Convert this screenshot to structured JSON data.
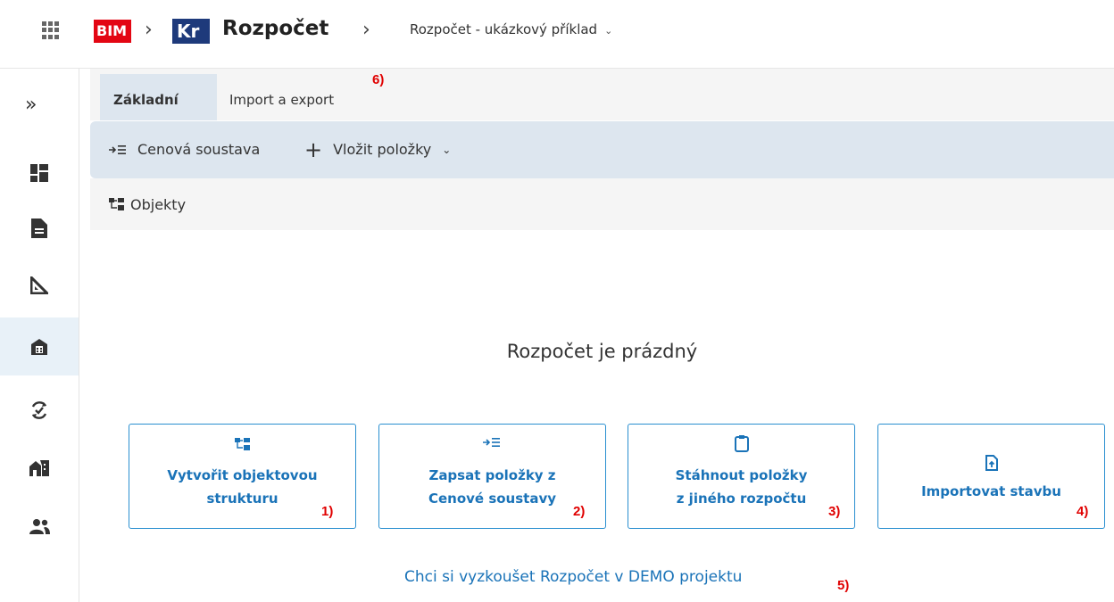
{
  "header": {
    "bim_logo": "BIM",
    "kr_logo": "Kr",
    "app_title": "Rozpočet",
    "project_name": "Rozpočet - ukázkový příklad"
  },
  "tabs": [
    {
      "label": "Základní"
    },
    {
      "label": "Import a export"
    }
  ],
  "toolbar": {
    "price_system": "Cenová soustava",
    "insert_items": "Vložit položky"
  },
  "subbar": {
    "objects": "Objekty"
  },
  "empty_state": {
    "title": "Rozpočet je prázdný",
    "cards": [
      {
        "line1": "Vytvořit objektovou",
        "line2": "strukturu",
        "marker": "1)"
      },
      {
        "line1": "Zapsat položky z",
        "line2": "Cenové soustavy",
        "marker": "2)"
      },
      {
        "line1": "Stáhnout položky",
        "line2": "z jiného rozpočtu",
        "marker": "3)"
      },
      {
        "line1": "Importovat stavbu",
        "marker": "4)"
      }
    ],
    "demo_link": "Chci si vyzkoušet Rozpočet v DEMO projektu",
    "demo_marker": "5)"
  },
  "tab_marker": "6)",
  "colors": {
    "accent": "#1a73b8",
    "card_border": "#2a8fd0",
    "marker": "#e00000",
    "toolbar_bg": "#dde6ef",
    "active_side": "#e8f1f8"
  }
}
